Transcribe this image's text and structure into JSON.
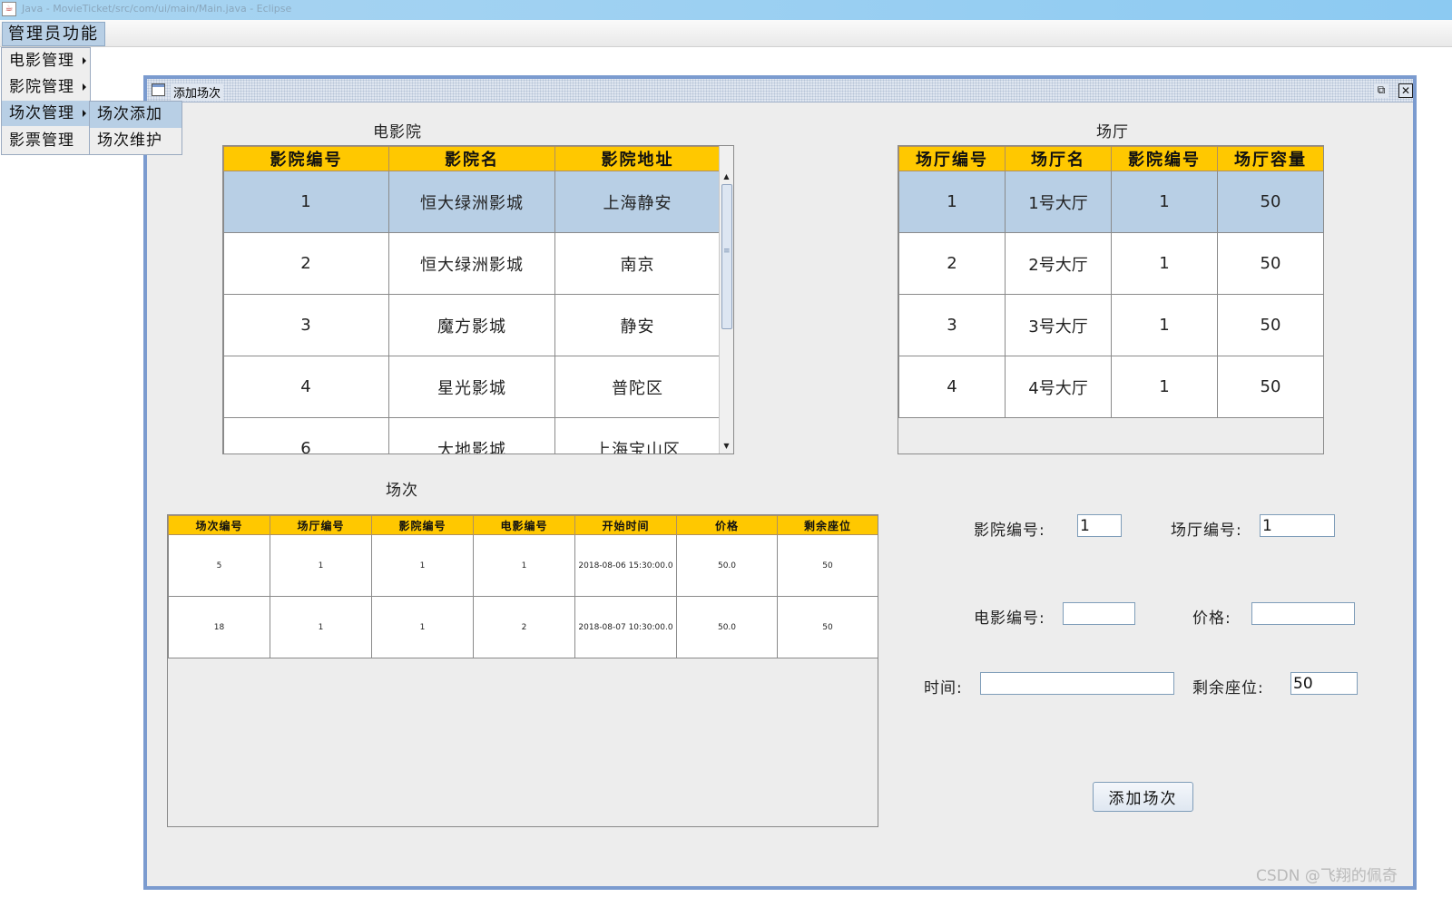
{
  "os_window": {
    "title": "Java - MovieTicket/src/com/ui/main/Main.java - Eclipse"
  },
  "menubar": {
    "admin_menu": "管理员功能"
  },
  "dropdown": {
    "items": [
      {
        "label": "电影管理"
      },
      {
        "label": "影院管理"
      },
      {
        "label": "场次管理"
      },
      {
        "label": "影票管理"
      }
    ],
    "submenu": [
      {
        "label": "场次添加"
      },
      {
        "label": "场次维护"
      }
    ]
  },
  "frame": {
    "title": "添加场次",
    "restore_icon": "restore-icon",
    "close_icon": "close-icon"
  },
  "cinema": {
    "caption": "电影院",
    "headers": [
      "影院编号",
      "影院名",
      "影院地址"
    ],
    "rows": [
      [
        "1",
        "恒大绿洲影城",
        "上海静安"
      ],
      [
        "2",
        "恒大绿洲影城",
        "南京"
      ],
      [
        "3",
        "魔方影城",
        "静安"
      ],
      [
        "4",
        "星光影城",
        "普陀区"
      ],
      [
        "6",
        "大地影城",
        "上海宝山区"
      ]
    ],
    "selected_row": 0
  },
  "hall": {
    "caption": "场厅",
    "headers": [
      "场厅编号",
      "场厅名",
      "影院编号",
      "场厅容量"
    ],
    "rows": [
      [
        "1",
        "1号大厅",
        "1",
        "50"
      ],
      [
        "2",
        "2号大厅",
        "1",
        "50"
      ],
      [
        "3",
        "3号大厅",
        "1",
        "50"
      ],
      [
        "4",
        "4号大厅",
        "1",
        "50"
      ]
    ],
    "selected_row": 0
  },
  "session": {
    "caption": "场次",
    "headers": [
      "场次编号",
      "场厅编号",
      "影院编号",
      "电影编号",
      "开始时间",
      "价格",
      "剩余座位"
    ],
    "rows": [
      [
        "5",
        "1",
        "1",
        "1",
        "2018-08-06 15:30:00.0",
        "50.0",
        "50"
      ],
      [
        "18",
        "1",
        "1",
        "2",
        "2018-08-07 10:30:00.0",
        "50.0",
        "50"
      ]
    ]
  },
  "form": {
    "cinema_id_label": "影院编号:",
    "cinema_id_value": "1",
    "hall_id_label": "场厅编号:",
    "hall_id_value": "1",
    "movie_id_label": "电影编号:",
    "movie_id_value": "",
    "price_label": "价格:",
    "price_value": "",
    "time_label": "时间:",
    "time_value": "",
    "seats_label": "剩余座位:",
    "seats_value": "50",
    "submit_label": "添加场次"
  },
  "watermark": "CSDN @飞翔的佩奇"
}
